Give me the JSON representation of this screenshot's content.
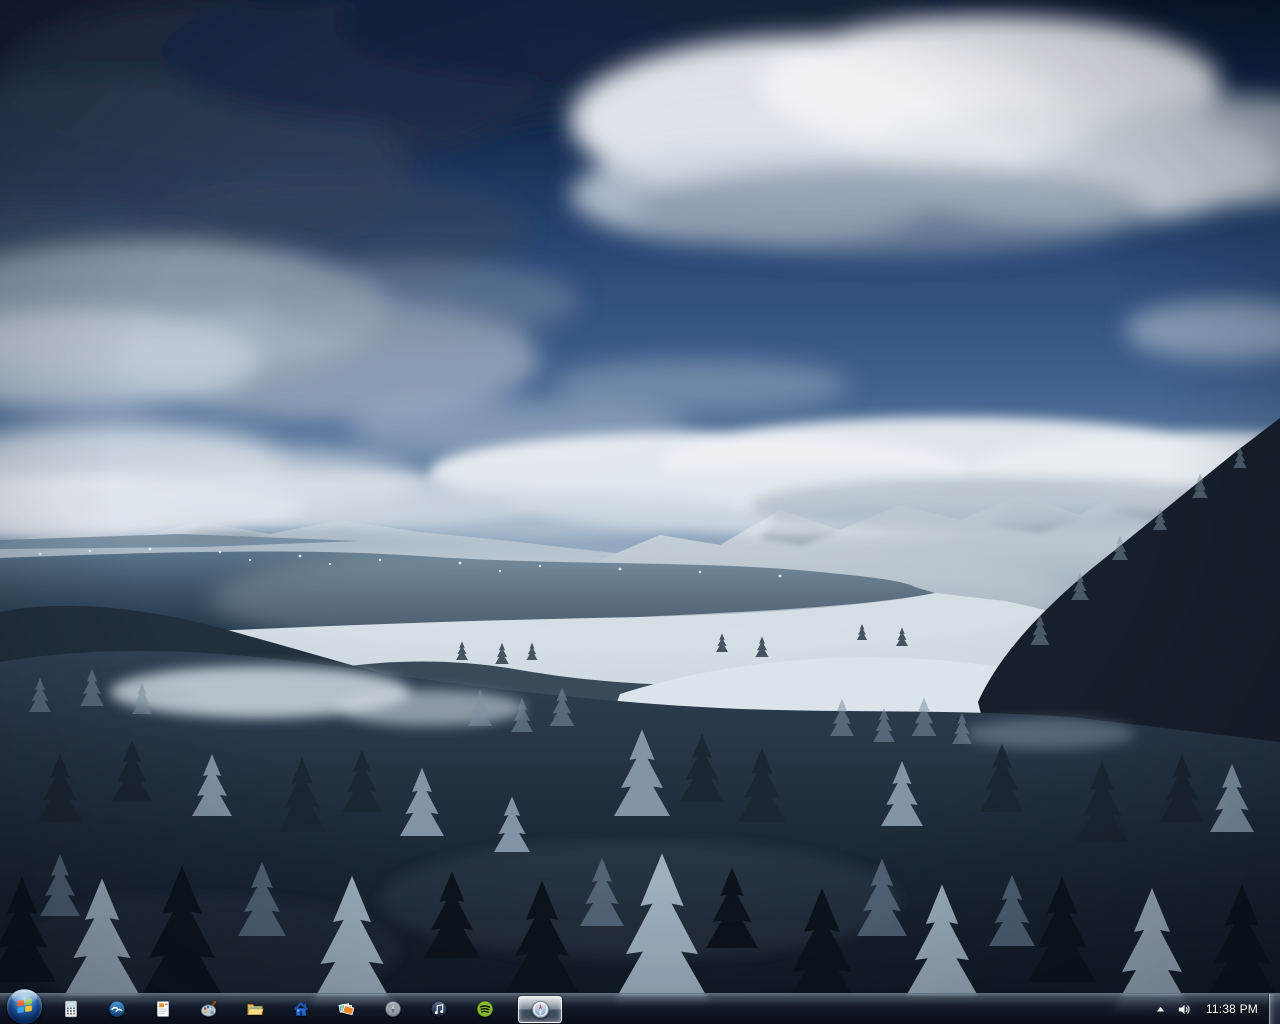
{
  "desktop": {
    "wallpaper": {
      "scene": "winter alpine panorama: dramatic cloudy blue sky, distant snowy mountain ranges, a long grey-blue lake, snow-covered villages and fields, dark frosted conifer forest in the foreground",
      "palette": {
        "sky_top": "#0a1630",
        "sky_mid": "#2b4a78",
        "horizon_haze": "#c2cfdb",
        "cloud_light": "#e9edf1",
        "cloud_dark": "#223149",
        "mountain_snow": "#d6dfe6",
        "lake": "#3a5166",
        "snow_field": "#cfdae2",
        "forest_dark": "#0e1723",
        "forest_frost": "#aebfcf"
      }
    }
  },
  "taskbar": {
    "start_button": {
      "icon": "windows-orb-icon"
    },
    "pinned_apps": [
      {
        "icon": "calculator-icon"
      },
      {
        "icon": "openoffice-icon"
      },
      {
        "icon": "text-document-icon"
      },
      {
        "icon": "paint-palette-icon"
      },
      {
        "icon": "folder-explorer-icon"
      },
      {
        "icon": "blue-house-icon"
      },
      {
        "icon": "photo-stack-icon"
      },
      {
        "icon": "compass-icon"
      },
      {
        "icon": "music-note-icon"
      },
      {
        "icon": "spotify-icon"
      }
    ],
    "open_apps": [
      {
        "icon": "compass-icon",
        "state": "active"
      }
    ],
    "system_tray": {
      "icons": [
        "show-hidden-icons-arrow-icon",
        "speaker-icon"
      ],
      "clock": {
        "time": "11:38 PM"
      }
    }
  }
}
